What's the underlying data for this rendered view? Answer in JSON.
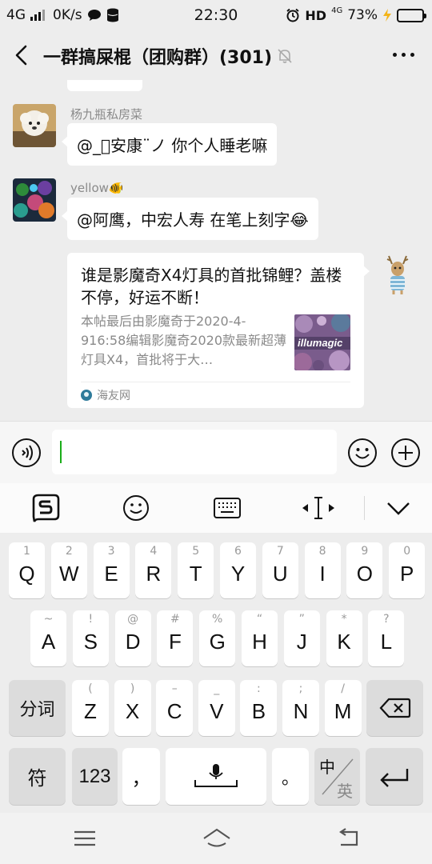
{
  "status_bar": {
    "network": "4G",
    "speed": "0K/s",
    "time": "22:30",
    "hd": "HD",
    "network_right": "4G",
    "battery": "73%",
    "battery_level": 0.73
  },
  "header": {
    "title": "一群搞屎棍（团购群）(301)"
  },
  "messages": [
    {
      "sender": "杨九瓶私房菜",
      "text": "@_ﾟ安康¨ノ 你个人睡老嘛"
    },
    {
      "sender": "yellow🐠",
      "text": "@阿鹰，中宏人寿  在笔上刻字😂"
    }
  ],
  "card": {
    "title": "谁是影魔奇X4灯具的首批锦鲤？盖楼不停，好运不断！",
    "description": "本帖最后由影魔奇于2020-4-916:58编辑影魔奇2020款最新超薄灯具X4，首批将于大…",
    "thumb_text": "illumagic",
    "source": "海友网"
  },
  "input": {
    "value": ""
  },
  "keyboard": {
    "row1": [
      {
        "hint": "1",
        "key": "Q"
      },
      {
        "hint": "2",
        "key": "W"
      },
      {
        "hint": "3",
        "key": "E"
      },
      {
        "hint": "4",
        "key": "R"
      },
      {
        "hint": "5",
        "key": "T"
      },
      {
        "hint": "6",
        "key": "Y"
      },
      {
        "hint": "7",
        "key": "U"
      },
      {
        "hint": "8",
        "key": "I"
      },
      {
        "hint": "9",
        "key": "O"
      },
      {
        "hint": "0",
        "key": "P"
      }
    ],
    "row2": [
      {
        "hint": "~",
        "key": "A"
      },
      {
        "hint": "!",
        "key": "S"
      },
      {
        "hint": "@",
        "key": "D"
      },
      {
        "hint": "#",
        "key": "F"
      },
      {
        "hint": "%",
        "key": "G"
      },
      {
        "hint": "“",
        "key": "H"
      },
      {
        "hint": "”",
        "key": "J"
      },
      {
        "hint": "*",
        "key": "K"
      },
      {
        "hint": "?",
        "key": "L"
      }
    ],
    "row3": [
      {
        "hint": "(",
        "key": "Z"
      },
      {
        "hint": ")",
        "key": "X"
      },
      {
        "hint": "–",
        "key": "C"
      },
      {
        "hint": "_",
        "key": "V"
      },
      {
        "hint": ":",
        "key": "B"
      },
      {
        "hint": ";",
        "key": "N"
      },
      {
        "hint": "/",
        "key": "M"
      }
    ],
    "split_label": "分词",
    "symbol_label": "符",
    "number_label": "123",
    "comma_label": "，",
    "period_label": "。",
    "lang_zh": "中",
    "lang_en": "英"
  }
}
